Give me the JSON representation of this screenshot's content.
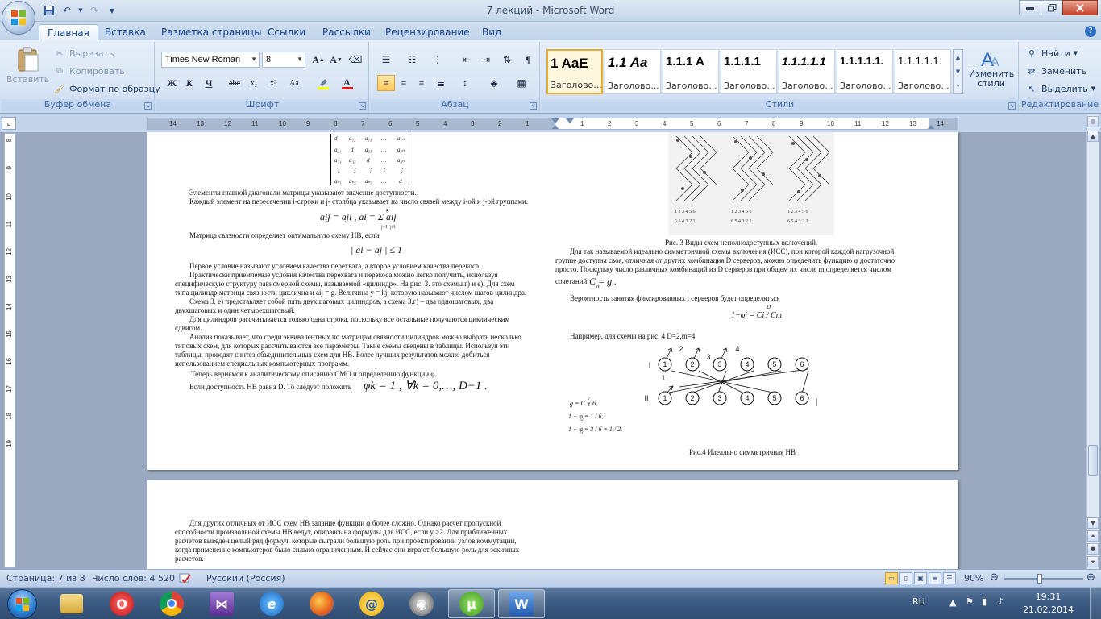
{
  "window": {
    "title": "7 лекций  -  Microsoft Word"
  },
  "qat": {
    "save": "save-icon",
    "undo": "undo-icon",
    "redo": "redo-icon",
    "customize": "▼"
  },
  "tabs": [
    "Главная",
    "Вставка",
    "Разметка страницы",
    "Ссылки",
    "Рассылки",
    "Рецензирование",
    "Вид"
  ],
  "ribbon": {
    "clipboard": {
      "paste": "Вставить",
      "cut": "Вырезать",
      "copy": "Копировать",
      "format_painter": "Формат по образцу",
      "label": "Буфер обмена"
    },
    "font": {
      "name": "Times New Roman",
      "size": "8",
      "label": "Шрифт",
      "bold": "Ж",
      "italic": "К",
      "underline": "Ч",
      "strike": "abe",
      "sub": "x₂",
      "sup": "x²",
      "case": "Aa"
    },
    "paragraph": {
      "label": "Абзац"
    },
    "styles": {
      "label": "Стили",
      "items": [
        {
          "sample": "1  AaE",
          "name": "Заголово..."
        },
        {
          "sample": "1.1  Aa",
          "name": "Заголово..."
        },
        {
          "sample": "1.1.1  A",
          "name": "Заголово..."
        },
        {
          "sample": "1.1.1.1",
          "name": "Заголово..."
        },
        {
          "sample": "1.1.1.1.1",
          "name": "Заголово..."
        },
        {
          "sample": "1.1.1.1.1.",
          "name": "Заголово..."
        },
        {
          "sample": "1.1.1.1.1.",
          "name": "Заголово..."
        }
      ],
      "change": "Изменить стили"
    },
    "editing": {
      "find": "Найти",
      "replace": "Заменить",
      "select": "Выделить",
      "label": "Редактирование"
    }
  },
  "ruler": {
    "left_ticks": [
      "14",
      "13",
      "12",
      "11",
      "10",
      "9",
      "8",
      "7",
      "6",
      "5",
      "4",
      "3",
      "2",
      "1"
    ],
    "right_ticks": [
      "1",
      "2",
      "3",
      "4",
      "5",
      "6",
      "7",
      "8",
      "9",
      "10",
      "11",
      "12",
      "13",
      "14"
    ],
    "vertical_ticks": [
      "8",
      "9",
      "10",
      "11",
      "12",
      "13",
      "14",
      "15",
      "16",
      "17",
      "18",
      "19"
    ]
  },
  "page1": {
    "left": [
      "Элементы главной диагонали матрицы указывают значение доступности.",
      "Каждый элемент на пересечении  i-строки и j- столбца указывает на число связей между i-ой и j-ой группами.",
      "Матрица связности определяет оптимальную схему НВ, если",
      "Первое условие называют условием качества перехвата, а второе условием качества перекоса.",
      "Практически  приемлемые условия качества перехвата и перекоса можно легко получить, используя",
      "специфическую структуру равномерной схемы, называемой «цилиндр». На рис. 3.  это схемы г) и е). Для схем",
      "типа цилиндр матрица связности циклична и aij = g. Величина y = kj,  которую  называют числом шагов цилиндра.",
      "Схема 3. е) представляет собой пять двухшаговых цилиндров, а схема 3.г) – два одношаговых, два",
      "двухшаговых и один четырехшаговый.",
      "Для цилиндров рассчитывается только одна строка, поскольку все остальные получаются циклическим",
      "сдвигом.",
      "Анализ показывает, что среди эквивалентных по матрицам связности цилиндров можно выбрать несколько",
      "типовых схем, для которых рассчитываются все параметры. Такие схемы сведены в таблицы. Используя эти",
      "таблицы, проводят синтез объединительных схем для НВ. Более лучших результатов можно добиться",
      "использованием специальных компьютерных программ.",
      "Теперь вернемся к аналитическому описанию СМО и определению функции φ.",
      "Если доступность НВ равна D. То следует положить"
    ],
    "formula1": "aij = aji ,  ai = Σ aij",
    "formula1_limits": {
      "top": "g",
      "bottom": "j=1, j≠i"
    },
    "formula2": "| ai − aj | ≤ 1",
    "formula3": "φk = 1 ,  ∀k = 0,…, D−1 .",
    "right": [
      "Рис. 3  Виды схем неполнодоступных включений.",
      "Для так называемой идеально симметричной схемы включения (ИСС), при которой каждой нагрузочной",
      "группе доступна своя, отличная от других комбинация D  серверов, можно определить функцию φ достаточно",
      "просто. Поскольку число различных комбинаций из D серверов при общем их числе m определяется числом",
      "сочетаний",
      "Вероятность занятия фиксированных i серверов будет определяться",
      "Например, для схемы на рис. 4  D=2,m=4,",
      "Рис.4  Идеально симметричная НВ"
    ],
    "formula_comb": "C = g .",
    "formula_comb_sup": "D",
    "formula_comb_sub": "m",
    "formula_prob": "1−φi = Ci / Cm",
    "formula_prob_sup": "D",
    "diagram": {
      "top_labels": [
        "2",
        "3",
        "4"
      ],
      "mid_label": "1",
      "row1_label": "I",
      "row2_label": "II",
      "nodes": [
        "1",
        "2",
        "3",
        "4",
        "5",
        "6"
      ]
    },
    "small_formulas": [
      "g = C  = 6,",
      "1 − φ  = 1 / 6,",
      "1 − φ  = 3 / 6 = 1 / 2."
    ],
    "small_formulas_sub": [
      "4",
      "2",
      "3"
    ],
    "small_formulas_sup": [
      "2",
      "",
      ""
    ]
  },
  "page2": {
    "lines": [
      "Для других отличных от ИСС схем НВ задание функции φ более сложно. Однако  расчет пропускной",
      "способности произвольной схемы НВ ведут, опираясь на формулы для ИСС, если y >2. Для приближенных",
      "расчетов выведен целый ряд формул, которые сыграли большую роль при проектировании узлов коммутации,",
      "когда применение компьютеров было сильно ограниченным. И сейчас они играют большую роль для эскизных",
      "расчетов."
    ]
  },
  "status": {
    "page": "Страница: 7 из 8",
    "words": "Число слов: 4 520",
    "language": "Русский (Россия)",
    "zoom": "90%",
    "zoom_level": 0.45
  },
  "taskbar": {
    "apps": [
      "explorer",
      "opera",
      "chrome",
      "visual-studio",
      "internet-explorer",
      "firefox",
      "mail",
      "steam",
      "utorrent",
      "word"
    ],
    "lang": "RU",
    "time": "19:31",
    "date": "21.02.2014"
  },
  "colors": {
    "ribbon": "#dbe7f6",
    "accent": "#15428b",
    "active_tab": "#ffffff"
  }
}
